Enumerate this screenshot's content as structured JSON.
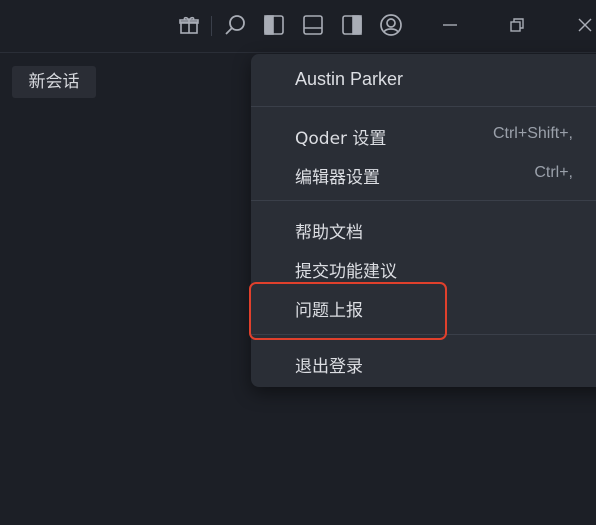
{
  "titlebar": {
    "icons": [
      "gift-icon",
      "search-icon",
      "toggle-left-panel-icon",
      "toggle-bottom-panel-icon",
      "toggle-right-panel-icon",
      "account-icon",
      "minimize-icon",
      "restore-icon",
      "close-icon"
    ]
  },
  "sidebar": {
    "new_chat_label": "新会话"
  },
  "account_menu": {
    "user_name": "Austin Parker",
    "items": [
      {
        "label": "Qoder 设置",
        "shortcut": "Ctrl+Shift+,"
      },
      {
        "label": "编辑器设置",
        "shortcut": "Ctrl+,"
      },
      {
        "label": "帮助文档"
      },
      {
        "label": "提交功能建议"
      },
      {
        "label": "问题上报"
      },
      {
        "label": "退出登录"
      }
    ]
  },
  "colors": {
    "background": "#1c1f26",
    "menu_background": "#2a2e36",
    "highlight": "#e0402c"
  }
}
